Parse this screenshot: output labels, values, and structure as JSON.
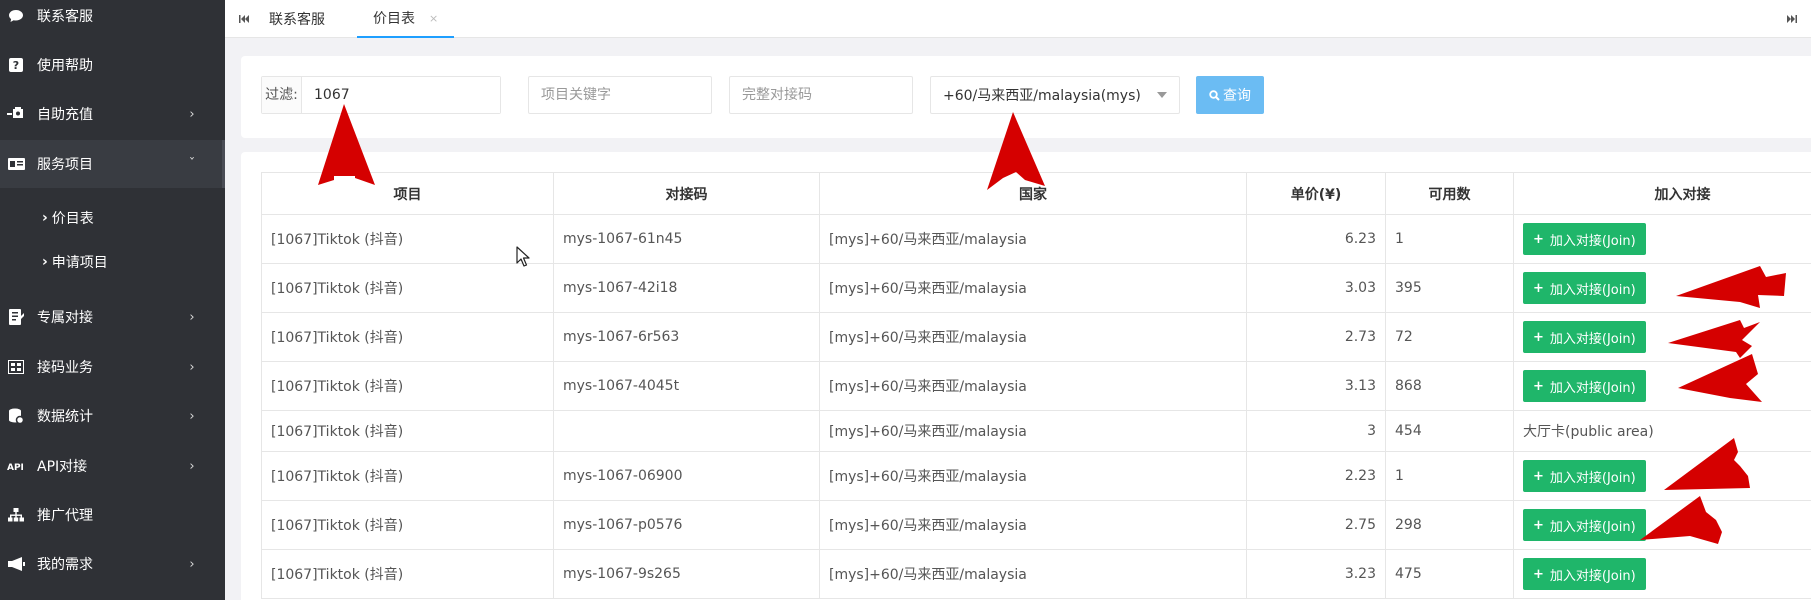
{
  "sidebar": {
    "items": [
      {
        "label": "联系客服",
        "icon": "chat-bubble-icon",
        "has_arrow": false
      },
      {
        "label": "使用帮助",
        "icon": "question-icon",
        "has_arrow": false
      },
      {
        "label": "自助充值",
        "icon": "recharge-icon",
        "has_arrow": true
      },
      {
        "label": "服务项目",
        "icon": "id-card-icon",
        "has_arrow": true,
        "expanded": true
      },
      {
        "label": "专属对接",
        "icon": "document-icon",
        "has_arrow": true
      },
      {
        "label": "接码业务",
        "icon": "grid-icon",
        "has_arrow": true
      },
      {
        "label": "数据统计",
        "icon": "database-icon",
        "has_arrow": true
      },
      {
        "label": "API对接",
        "icon": "api-icon",
        "has_arrow": true
      },
      {
        "label": "推广代理",
        "icon": "sitemap-icon",
        "has_arrow": false
      },
      {
        "label": "我的需求",
        "icon": "megaphone-icon",
        "has_arrow": true
      }
    ],
    "sub_items": [
      {
        "label": "价目表"
      },
      {
        "label": "申请项目"
      }
    ]
  },
  "tabs": {
    "items": [
      {
        "label": "联系客服",
        "active": false
      },
      {
        "label": "价目表",
        "active": true,
        "closable": true
      }
    ],
    "close_glyph": "×"
  },
  "filter": {
    "label": "过滤:",
    "value": "1067",
    "keyword_placeholder": "项目关键字",
    "code_placeholder": "完整对接码",
    "country_selected": "+60/马来西亚/malaysia(mys)",
    "query_label": "查询",
    "query_icon": "search-icon"
  },
  "table": {
    "columns": [
      "项目",
      "对接码",
      "国家",
      "单价(¥)",
      "可用数",
      "加入对接"
    ],
    "join_label": "加入对接(Join)",
    "rows": [
      {
        "project": "[1067]Tiktok (抖音)",
        "code": "mys-1067-61n45",
        "country": "[mys]+60/马来西亚/malaysia",
        "price": "6.23",
        "available": "1",
        "join": true
      },
      {
        "project": "[1067]Tiktok (抖音)",
        "code": "mys-1067-42i18",
        "country": "[mys]+60/马来西亚/malaysia",
        "price": "3.03",
        "available": "395",
        "join": true
      },
      {
        "project": "[1067]Tiktok (抖音)",
        "code": "mys-1067-6r563",
        "country": "[mys]+60/马来西亚/malaysia",
        "price": "2.73",
        "available": "72",
        "join": true
      },
      {
        "project": "[1067]Tiktok (抖音)",
        "code": "mys-1067-4045t",
        "country": "[mys]+60/马来西亚/malaysia",
        "price": "3.13",
        "available": "868",
        "join": true
      },
      {
        "project": "[1067]Tiktok (抖音)",
        "code": "",
        "country": "[mys]+60/马来西亚/malaysia",
        "price": "3",
        "available": "454",
        "join": false,
        "join_text": "大厅卡(public area)"
      },
      {
        "project": "[1067]Tiktok (抖音)",
        "code": "mys-1067-06900",
        "country": "[mys]+60/马来西亚/malaysia",
        "price": "2.23",
        "available": "1",
        "join": true
      },
      {
        "project": "[1067]Tiktok (抖音)",
        "code": "mys-1067-p0576",
        "country": "[mys]+60/马来西亚/malaysia",
        "price": "2.75",
        "available": "298",
        "join": true
      },
      {
        "project": "[1067]Tiktok (抖音)",
        "code": "mys-1067-9s265",
        "country": "[mys]+60/马来西亚/malaysia",
        "price": "3.23",
        "available": "475",
        "join": true
      }
    ]
  },
  "colors": {
    "sidebar_bg": "#2f3136",
    "accent_blue": "#1e9fff",
    "join_green": "#1fb66a",
    "price_green": "#3a9d23",
    "annotation_red": "#d50000"
  }
}
